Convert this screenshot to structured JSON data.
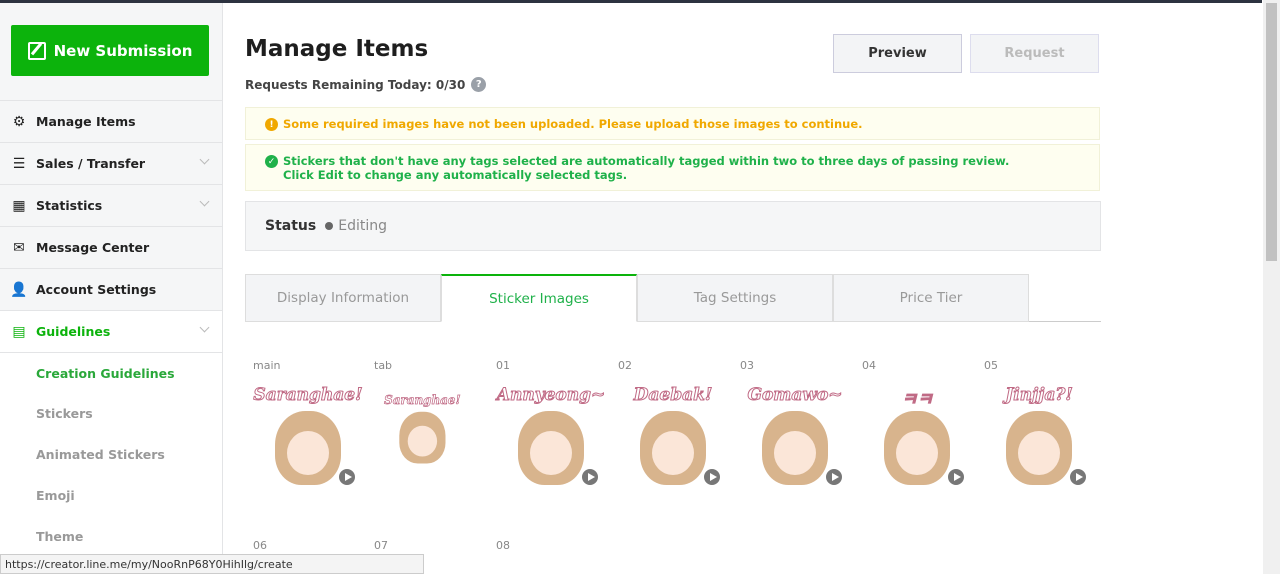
{
  "sidebar": {
    "new_submission": "New Submission",
    "items": [
      {
        "label": "Manage Items",
        "icon": "gear-icon"
      },
      {
        "label": "Sales / Transfer",
        "icon": "database-icon"
      },
      {
        "label": "Statistics",
        "icon": "bar-chart-icon"
      },
      {
        "label": "Message Center",
        "icon": "envelope-icon"
      },
      {
        "label": "Account Settings",
        "icon": "user-icon"
      },
      {
        "label": "Guidelines",
        "icon": "document-icon"
      }
    ],
    "sub_items": [
      "Creation Guidelines",
      "Stickers",
      "Animated Stickers",
      "Emoji",
      "Theme"
    ]
  },
  "header": {
    "title": "Manage Items",
    "remaining_label": "Requests Remaining Today: 0/30",
    "preview": "Preview",
    "request": "Request"
  },
  "alerts": {
    "warning": "Some required images have not been uploaded. Please upload those images to continue.",
    "info_line1": "Stickers that don't have any tags selected are automatically tagged within two to three days of passing review.",
    "info_line2": "Click Edit to change any automatically selected tags."
  },
  "status": {
    "label": "Status",
    "value": "Editing"
  },
  "tabs": [
    "Display Information",
    "Sticker Images",
    "Tag Settings",
    "Price Tier"
  ],
  "stickers": [
    {
      "label": "main",
      "text": "Saranghae!"
    },
    {
      "label": "tab",
      "text": "Saranghae!"
    },
    {
      "label": "01",
      "text": "Annyeong~"
    },
    {
      "label": "02",
      "text": "Daebak!"
    },
    {
      "label": "03",
      "text": "Gomawo~"
    },
    {
      "label": "04",
      "text": "ㅋㅋ"
    },
    {
      "label": "05",
      "text": "Jinjja?!"
    }
  ],
  "stickers_row2": [
    "06",
    "07",
    "08"
  ],
  "browser_status": "https://creator.line.me/my/NooRnP68Y0HihIlg/create",
  "colors": {
    "brand": "#0cb30c",
    "warning": "#f0a800",
    "success": "#1fb14a"
  }
}
